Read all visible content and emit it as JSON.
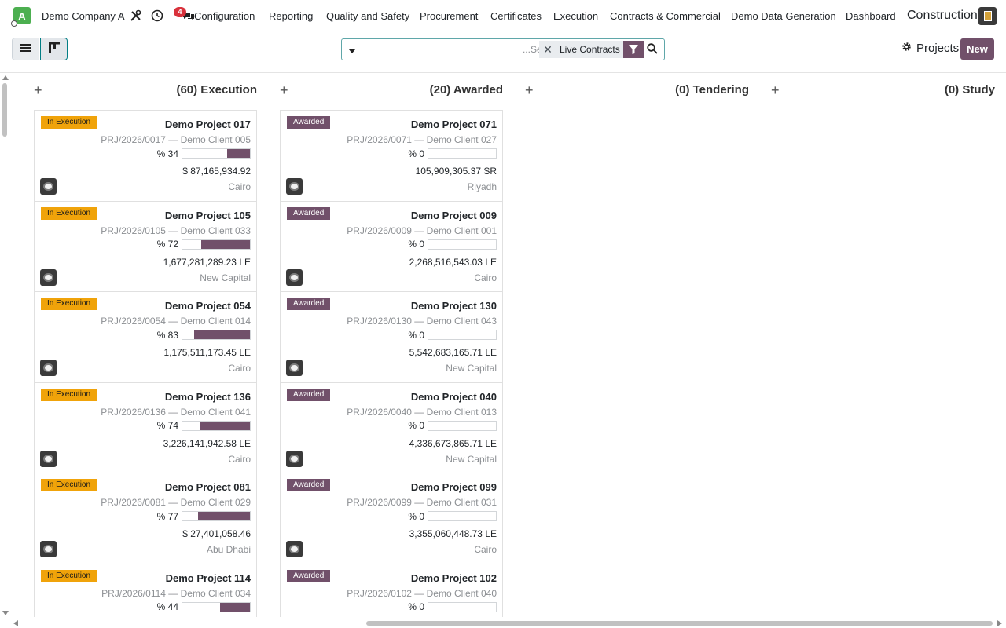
{
  "navbar": {
    "avatar_letter": "A",
    "company": "Demo Company A",
    "badge_count": "4",
    "menus": [
      "Configuration",
      "Reporting",
      "Quality and Safety",
      "Procurement",
      "Certificates",
      "Execution",
      "Contracts & Commercial",
      "Demo Data Generation",
      "Dashboard"
    ],
    "app_title": "Construction"
  },
  "control": {
    "search_placeholder": "...Search",
    "facet_label": "Live Contracts",
    "projects_label": "Projects",
    "new_label": "New"
  },
  "columns": [
    {
      "title": "(60) Execution"
    },
    {
      "title": "(20) Awarded"
    },
    {
      "title": "(0) Tendering"
    },
    {
      "title": "(0) Study"
    }
  ],
  "execution_cards": [
    {
      "badge": "In Execution",
      "name": "Demo Project 017",
      "ref": "PRJ/2026/0017 — Demo Client 005",
      "progress_label": "% 34",
      "progress": 34,
      "amount": "$ 87,165,934.92",
      "city": "Cairo"
    },
    {
      "badge": "In Execution",
      "name": "Demo Project 105",
      "ref": "PRJ/2026/0105 — Demo Client 033",
      "progress_label": "% 72",
      "progress": 72,
      "amount": "1,677,281,289.23 LE",
      "city": "New Capital"
    },
    {
      "badge": "In Execution",
      "name": "Demo Project 054",
      "ref": "PRJ/2026/0054 — Demo Client 014",
      "progress_label": "% 83",
      "progress": 83,
      "amount": "1,175,511,173.45 LE",
      "city": "Cairo"
    },
    {
      "badge": "In Execution",
      "name": "Demo Project 136",
      "ref": "PRJ/2026/0136 — Demo Client 041",
      "progress_label": "% 74",
      "progress": 74,
      "amount": "3,226,141,942.58 LE",
      "city": "Cairo"
    },
    {
      "badge": "In Execution",
      "name": "Demo Project 081",
      "ref": "PRJ/2026/0081 — Demo Client 029",
      "progress_label": "% 77",
      "progress": 77,
      "amount": "$ 27,401,058.46",
      "city": "Abu Dhabi"
    },
    {
      "badge": "In Execution",
      "name": "Demo Project 114",
      "ref": "PRJ/2026/0114 — Demo Client 034",
      "progress_label": "% 44",
      "progress": 44,
      "amount": "",
      "city": ""
    }
  ],
  "awarded_cards": [
    {
      "badge": "Awarded",
      "name": "Demo Project 071",
      "ref": "PRJ/2026/0071 — Demo Client 027",
      "progress_label": "% 0",
      "progress": 0,
      "amount": "105,909,305.37 SR",
      "city": "Riyadh"
    },
    {
      "badge": "Awarded",
      "name": "Demo Project 009",
      "ref": "PRJ/2026/0009 — Demo Client 001",
      "progress_label": "% 0",
      "progress": 0,
      "amount": "2,268,516,543.03 LE",
      "city": "Cairo"
    },
    {
      "badge": "Awarded",
      "name": "Demo Project 130",
      "ref": "PRJ/2026/0130 — Demo Client 043",
      "progress_label": "% 0",
      "progress": 0,
      "amount": "5,542,683,165.71 LE",
      "city": "New Capital"
    },
    {
      "badge": "Awarded",
      "name": "Demo Project 040",
      "ref": "PRJ/2026/0040 — Demo Client 013",
      "progress_label": "% 0",
      "progress": 0,
      "amount": "4,336,673,865.71 LE",
      "city": "New Capital"
    },
    {
      "badge": "Awarded",
      "name": "Demo Project 099",
      "ref": "PRJ/2026/0099 — Demo Client 031",
      "progress_label": "% 0",
      "progress": 0,
      "amount": "3,355,060,448.73 LE",
      "city": "Cairo"
    },
    {
      "badge": "Awarded",
      "name": "Demo Project 102",
      "ref": "PRJ/2026/0102 — Demo Client 040",
      "progress_label": "% 0",
      "progress": 0,
      "amount": "",
      "city": ""
    }
  ],
  "colors": {
    "primary": "#71506a",
    "execution_badge": "#f0a30a",
    "accent": "#017e84"
  },
  "icons": {
    "tools": "tools-icon",
    "clock": "clock-icon",
    "chat": "chat-icon",
    "gear": "gear-icon",
    "filter": "filter-icon",
    "search": "search-icon"
  }
}
